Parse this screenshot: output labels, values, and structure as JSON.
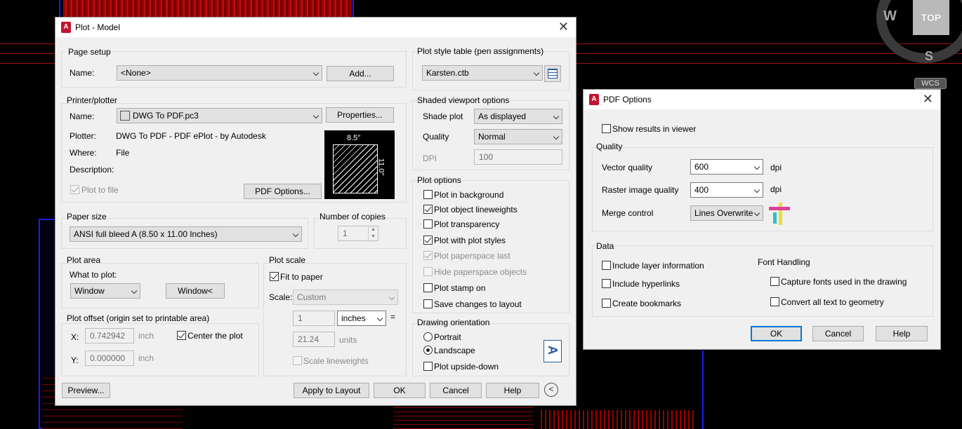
{
  "plot_dialog": {
    "title": "Plot - Model",
    "page_setup": {
      "group": "Page setup",
      "name_label": "Name:",
      "name_value": "<None>",
      "add_button": "Add..."
    },
    "printer": {
      "group": "Printer/plotter",
      "name_label": "Name:",
      "name_value": "DWG To PDF.pc3",
      "properties_button": "Properties...",
      "plotter_label": "Plotter:",
      "plotter_value": "DWG To PDF - PDF ePlot - by Autodesk",
      "where_label": "Where:",
      "where_value": "File",
      "description_label": "Description:",
      "plot_to_file": "Plot to file",
      "pdf_options_button": "PDF Options...",
      "preview_width": "8.5\"",
      "preview_height": "11.0\""
    },
    "paper_size": {
      "group": "Paper size",
      "value": "ANSI full bleed A (8.50 x 11.00 Inches)"
    },
    "copies": {
      "group": "Number of copies",
      "value": "1"
    },
    "plot_area": {
      "group": "Plot area",
      "what_label": "What to plot:",
      "what_value": "Window",
      "window_button": "Window<"
    },
    "plot_offset": {
      "group": "Plot offset (origin set to printable area)",
      "x_label": "X:",
      "x_value": "0.742942",
      "x_unit": "inch",
      "y_label": "Y:",
      "y_value": "0.000000",
      "y_unit": "inch",
      "center_label": "Center the plot"
    },
    "plot_scale": {
      "group": "Plot scale",
      "fit_label": "Fit to paper",
      "scale_label": "Scale:",
      "scale_value": "Custom",
      "num_value": "1",
      "unit_value": "inches",
      "equals": "=",
      "den_value": "21.24",
      "den_unit": "units",
      "lineweights_label": "Scale lineweights"
    },
    "style_table": {
      "group": "Plot style table (pen assignments)",
      "value": "Karsten.ctb"
    },
    "shaded": {
      "group": "Shaded viewport options",
      "shade_label": "Shade plot",
      "shade_value": "As displayed",
      "quality_label": "Quality",
      "quality_value": "Normal",
      "dpi_label": "DPI",
      "dpi_value": "100"
    },
    "plot_options": {
      "group": "Plot options",
      "items": [
        "Plot in background",
        "Plot object lineweights",
        "Plot transparency",
        "Plot with plot styles",
        "Plot paperspace last",
        "Hide paperspace objects",
        "Plot stamp on",
        "Save changes to layout"
      ]
    },
    "orientation": {
      "group": "Drawing orientation",
      "portrait": "Portrait",
      "landscape": "Landscape",
      "upside_down": "Plot upside-down"
    },
    "footer": {
      "preview": "Preview...",
      "apply": "Apply to Layout",
      "ok": "OK",
      "cancel": "Cancel",
      "help": "Help"
    }
  },
  "pdf_dialog": {
    "title": "PDF Options",
    "show_results": "Show results in viewer",
    "quality_group": "Quality",
    "vector_label": "Vector quality",
    "vector_value": "600",
    "vector_unit": "dpi",
    "raster_label": "Raster image quality",
    "raster_value": "400",
    "raster_unit": "dpi",
    "merge_label": "Merge control",
    "merge_value": "Lines Overwrite",
    "data_group": "Data",
    "include_layer": "Include layer information",
    "include_hyperlinks": "Include hyperlinks",
    "create_bookmarks": "Create bookmarks",
    "font_handling": "Font Handling",
    "capture_fonts": "Capture fonts used in the drawing",
    "convert_text": "Convert all text to geometry",
    "ok": "OK",
    "cancel": "Cancel",
    "help": "Help"
  },
  "viewcube": {
    "top": "TOP",
    "west": "W",
    "south": "S",
    "wcs": "WCS"
  }
}
